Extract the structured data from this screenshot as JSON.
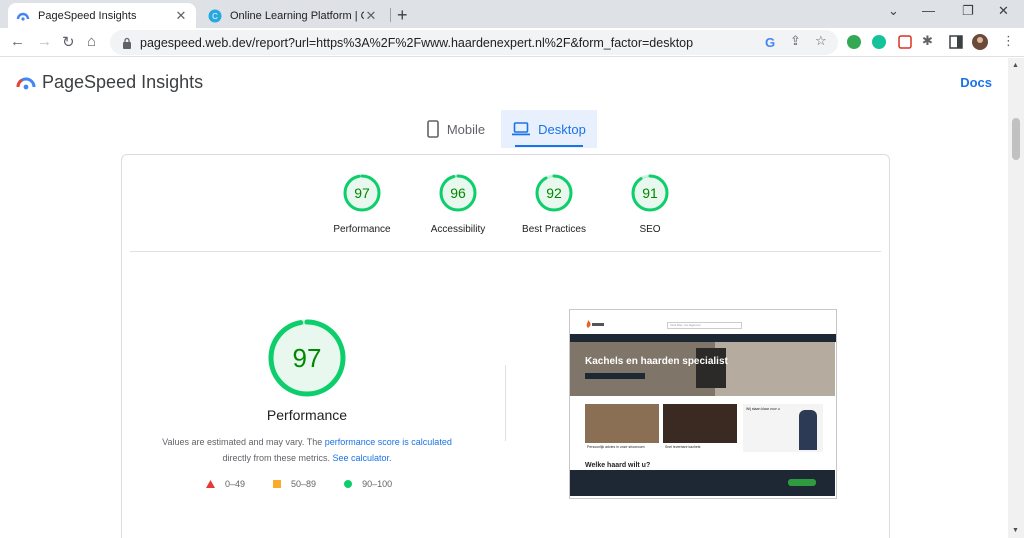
{
  "browser": {
    "tabs": [
      {
        "title": "PageSpeed Insights",
        "active": true
      },
      {
        "title": "Online Learning Platform | Corpo",
        "active": false
      }
    ],
    "url": "pagespeed.web.dev/report?url=https%3A%2F%2Fwww.haardenexpert.nl%2F&form_factor=desktop"
  },
  "psi": {
    "title": "PageSpeed Insights",
    "docs": "Docs",
    "device_tabs": [
      {
        "label": "Mobile",
        "icon": "phone-icon",
        "active": false
      },
      {
        "label": "Desktop",
        "icon": "laptop-icon",
        "active": true
      }
    ],
    "scores": [
      {
        "label": "Performance",
        "value": 97
      },
      {
        "label": "Accessibility",
        "value": 96
      },
      {
        "label": "Best Practices",
        "value": 92
      },
      {
        "label": "SEO",
        "value": 91
      }
    ],
    "main": {
      "score": 97,
      "label": "Performance",
      "disclaimer_1": "Values are estimated and may vary. The",
      "disclaimer_link_1": "performance score is calculated",
      "disclaimer_2": "directly from these metrics.",
      "disclaimer_link_2": "See calculator."
    },
    "legend": [
      {
        "label": "0–49",
        "color": "#e53935",
        "shape": "triangle"
      },
      {
        "label": "50–89",
        "color": "#fbaa2b",
        "shape": "square"
      },
      {
        "label": "90–100",
        "color": "#0cce6b",
        "shape": "circle"
      }
    ],
    "screenshot": {
      "hero_heading": "Kachels en haarden specialist",
      "search_placeholder": "Vind filter, zet bijgevoel",
      "tiles": [
        "Persoonlijk advies in onze showroom",
        "Snel leverbare kachels",
        "Wij staan klaar voor u"
      ],
      "section_heading": "Welke haard wilt u?"
    }
  },
  "colors": {
    "accent": "#1a73e8",
    "pass": "#0cce6b",
    "pass_text": "#008800"
  }
}
